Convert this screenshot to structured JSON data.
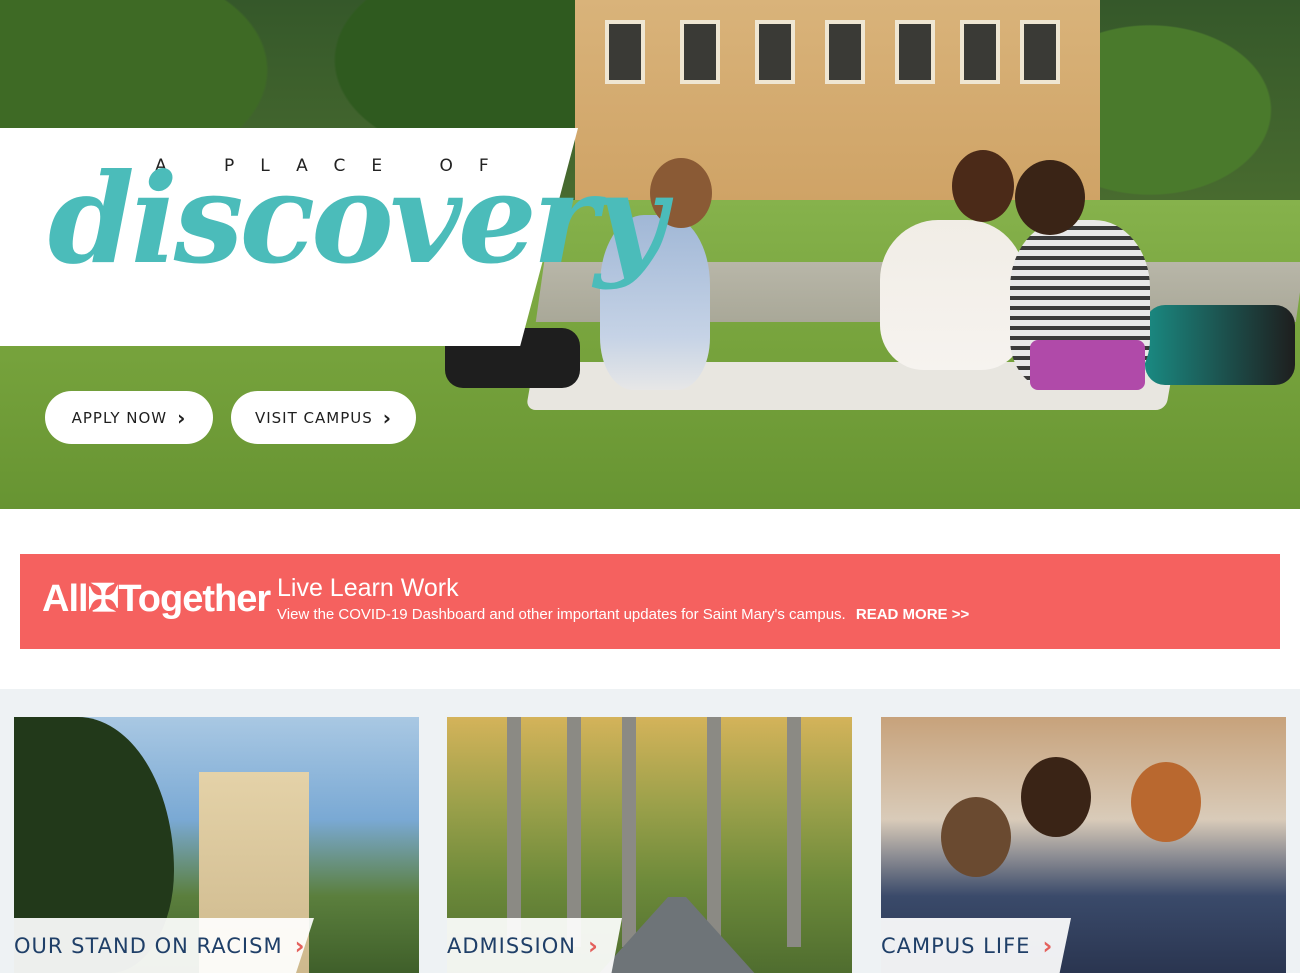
{
  "hero": {
    "kicker": "A PLACE OF",
    "script_word": "discovery",
    "apply_label": "APPLY NOW",
    "visit_label": "VISIT CAMPUS",
    "chevron": "›"
  },
  "alert": {
    "logo": "All✠Together",
    "title": "Live Learn Work",
    "text": "View the COVID-19 Dashboard and other important updates for Saint Mary's campus.",
    "link": "READ MORE >>"
  },
  "cards": [
    {
      "label": "OUR STAND ON RACISM"
    },
    {
      "label": "ADMISSION"
    },
    {
      "label": "CAMPUS LIFE"
    }
  ],
  "colors": {
    "accent_teal": "#4bbcba",
    "alert_red": "#f5615f",
    "navy": "#1f3f68",
    "chevron_red": "#e4605c"
  },
  "icons": {
    "cta_chevron": "chevron-right-icon",
    "card_chevron": "chevron-right-icon"
  }
}
